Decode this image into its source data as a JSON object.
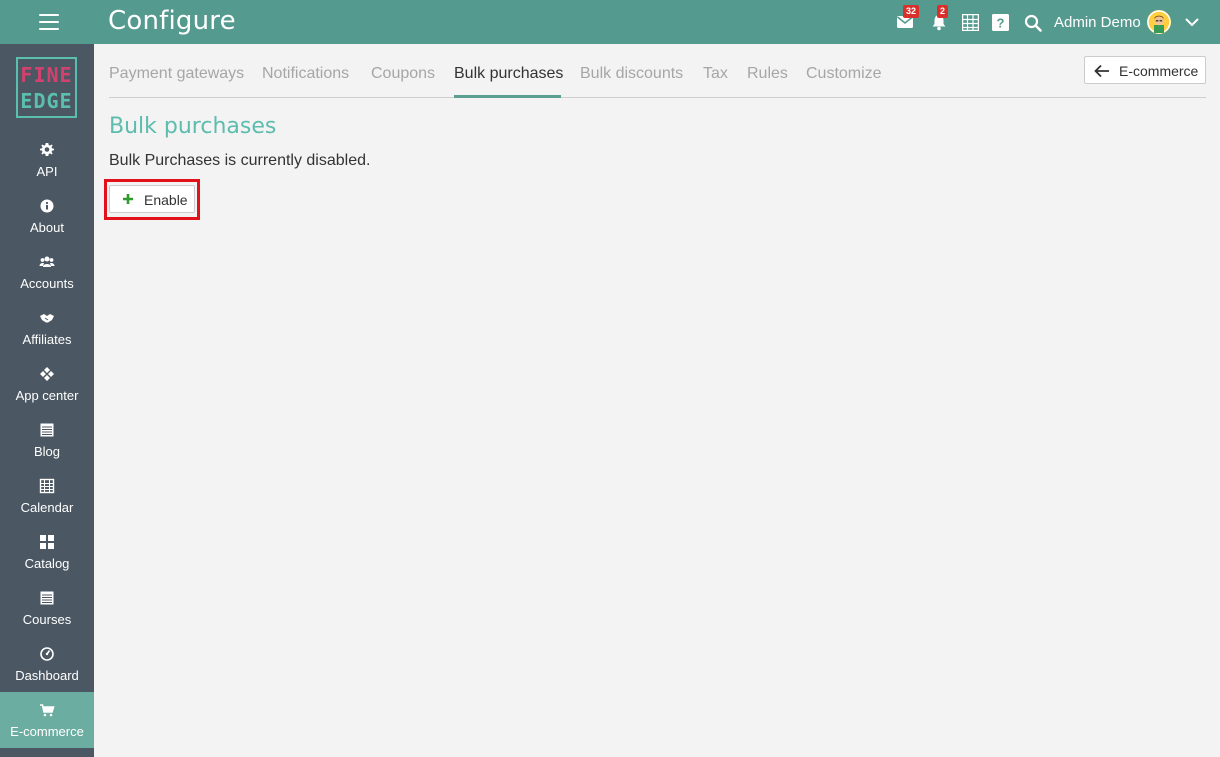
{
  "header": {
    "title": "Configure",
    "messages_badge": "32",
    "notifications_badge": "2",
    "user_name": "Admin Demo"
  },
  "logo": {
    "line1": "FINE",
    "line2": "EDGE"
  },
  "sidebar": {
    "items": [
      {
        "label": "API",
        "icon": "gear-icon"
      },
      {
        "label": "About",
        "icon": "info-icon"
      },
      {
        "label": "Accounts",
        "icon": "users-icon"
      },
      {
        "label": "Affiliates",
        "icon": "handshake-icon"
      },
      {
        "label": "App center",
        "icon": "apps-icon"
      },
      {
        "label": "Blog",
        "icon": "blog-icon"
      },
      {
        "label": "Calendar",
        "icon": "calendar-icon"
      },
      {
        "label": "Catalog",
        "icon": "catalog-icon"
      },
      {
        "label": "Courses",
        "icon": "courses-icon"
      },
      {
        "label": "Dashboard",
        "icon": "dashboard-icon"
      },
      {
        "label": "E-commerce",
        "icon": "cart-icon",
        "active": true
      }
    ]
  },
  "tabs": [
    {
      "label": "Payment gateways"
    },
    {
      "label": "Notifications"
    },
    {
      "label": "Coupons"
    },
    {
      "label": "Bulk purchases",
      "active": true
    },
    {
      "label": "Bulk discounts"
    },
    {
      "label": "Tax"
    },
    {
      "label": "Rules"
    },
    {
      "label": "Customize"
    }
  ],
  "back_button": {
    "label": "E-commerce"
  },
  "main": {
    "title": "Bulk purchases",
    "status": "Bulk Purchases is currently disabled.",
    "enable_label": "Enable"
  },
  "colors": {
    "topbar": "#559a8e",
    "sidebar": "#4b5762",
    "sidebar_active": "#6bada1",
    "accent_title": "#5cbcae",
    "highlight": "#e2111a",
    "badge": "#d9302c"
  }
}
